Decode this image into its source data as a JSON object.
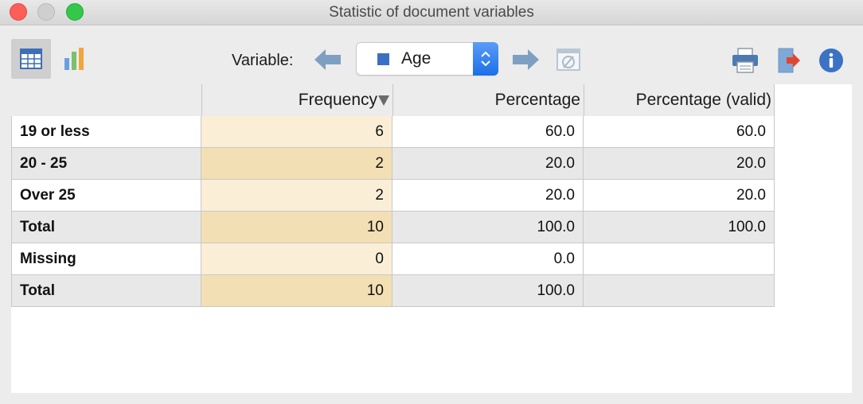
{
  "window": {
    "title": "Statistic of document variables"
  },
  "toolbar": {
    "variable_label": "Variable:",
    "selected_variable": "Age",
    "icons": {
      "table_view": "table-icon",
      "chart_view": "bar-chart-icon",
      "previous": "arrow-left-icon",
      "next": "arrow-right-icon",
      "no_variable": "empty-set-icon",
      "print": "printer-icon",
      "export": "export-icon",
      "info": "info-icon"
    },
    "colors": {
      "variable_square": "#3b6fc4",
      "stepper": "#1b6fe9",
      "export_arrow": "#e2452f",
      "info": "#3b72c4"
    }
  },
  "table": {
    "columns": [
      "",
      "Frequency",
      "Percentage",
      "Percentage (valid)"
    ],
    "rows": [
      {
        "label": "19 or less",
        "frequency": "6",
        "percentage": "60.0",
        "valid": "60.0"
      },
      {
        "label": "20 - 25",
        "frequency": "2",
        "percentage": "20.0",
        "valid": "20.0"
      },
      {
        "label": "Over 25",
        "frequency": "2",
        "percentage": "20.0",
        "valid": "20.0"
      },
      {
        "label": "Total",
        "frequency": "10",
        "percentage": "100.0",
        "valid": "100.0"
      },
      {
        "label": "Missing",
        "frequency": "0",
        "percentage": "0.0",
        "valid": ""
      },
      {
        "label": "Total",
        "frequency": "10",
        "percentage": "100.0",
        "valid": ""
      }
    ]
  }
}
